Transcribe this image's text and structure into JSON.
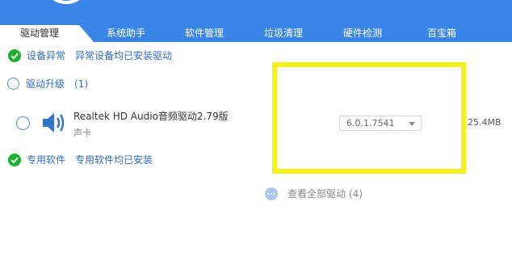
{
  "tabs": [
    {
      "label": "驱动管理",
      "active": true
    },
    {
      "label": "系统助手"
    },
    {
      "label": "软件管理"
    },
    {
      "label": "垃圾清理"
    },
    {
      "label": "硬件检测"
    },
    {
      "label": "百宝箱"
    }
  ],
  "device_abnormal": {
    "title": "设备异常",
    "message": "异常设备均已安装驱动"
  },
  "driver_upgrade": {
    "title": "驱动升级",
    "count": "(1)"
  },
  "driver_item": {
    "name": "Realtek HD Audio音频驱动2.79版",
    "category": "声卡",
    "version": "6.0.1.7541",
    "size": "25.4MB",
    "icon": "speaker-icon"
  },
  "special_software": {
    "title": "专用软件",
    "message": "专用软件均已安装"
  },
  "view_all": {
    "label": "查看全部驱动",
    "count": "(4)"
  },
  "colors": {
    "accent": "#3a86e6",
    "check": "#1bb12c",
    "highlight": "#f4f21a"
  }
}
